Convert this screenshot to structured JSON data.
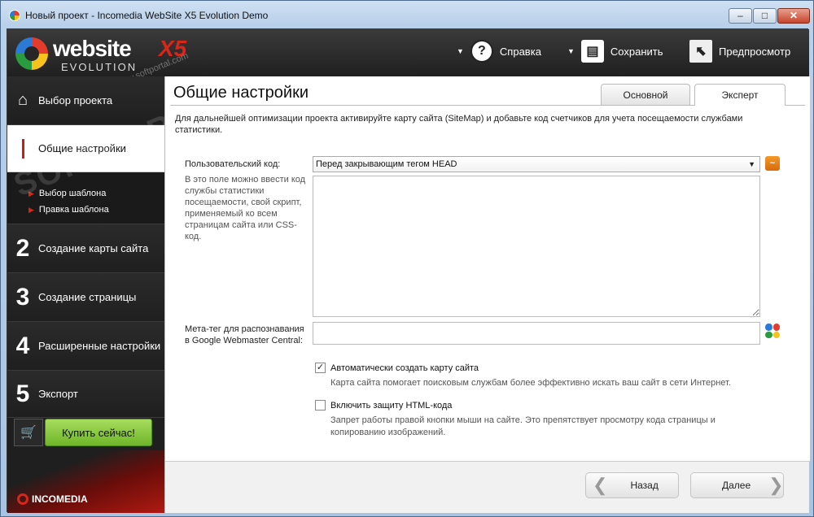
{
  "window": {
    "title": "Новый проект - Incomedia WebSite X5 Evolution Demo",
    "min": "–",
    "max": "□",
    "close": "✕"
  },
  "logo": {
    "main": "website",
    "mark": "X5",
    "sub": "EVOLUTION"
  },
  "watermark": {
    "big": "SOFTPORTAL",
    "small": "www.softportal.com"
  },
  "header": {
    "help_label": "Справка",
    "save_label": "Сохранить",
    "preview_label": "Предпросмотр"
  },
  "sidebar": {
    "home_label": "Выбор проекта",
    "general_label": "Общие настройки",
    "sub_items": [
      "Выбор шаблона",
      "Правка шаблона"
    ],
    "steps": [
      {
        "num": "2",
        "label": "Создание карты сайта"
      },
      {
        "num": "3",
        "label": "Создание страницы"
      },
      {
        "num": "4",
        "label": "Расширенные настройки"
      },
      {
        "num": "5",
        "label": "Экспорт"
      }
    ],
    "buy_label": "Купить сейчас!",
    "brand": "INCOMEDIA"
  },
  "main": {
    "title": "Общие настройки",
    "tabs": [
      "Основной",
      "Эксперт"
    ],
    "active_tab": "Эксперт",
    "intro": "Для дальнейшей оптимизации проекта активируйте карту сайта (SiteMap) и добавьте код счетчиков для учета посещаемости службами статистики.",
    "user_code_label": "Пользовательский код:",
    "user_code_select": "Перед закрывающим тегом HEAD",
    "user_code_hint": "В это поле можно ввести код службы статистики посещаемости, свой скрипт, применяемый ко всем страницам сайта или CSS-код.",
    "user_code_value": "",
    "meta_label": "Мета-тег для распознавания в Google Webmaster Central:",
    "meta_value": "",
    "sitemap_check_label": "Автоматически создать карту сайта",
    "sitemap_checked": true,
    "sitemap_note": "Карта сайта помогает поисковым службам более эффективно искать ваш сайт в сети Интернет.",
    "html_check_label": "Включить защиту HTML-кода",
    "html_checked": false,
    "html_note": "Запрет работы правой кнопки мыши на сайте. Это препятствует просмотру кода страницы и копированию изображений."
  },
  "footer": {
    "back_label": "Назад",
    "next_label": "Далее"
  },
  "colors": {
    "accent_red": "#c4201a",
    "buy_green": "#8bca3f",
    "dark_bg": "#1f1f1f"
  }
}
